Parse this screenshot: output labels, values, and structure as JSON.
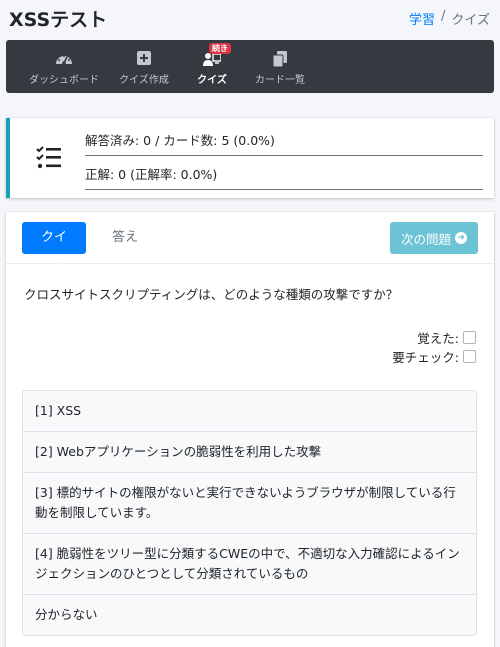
{
  "header": {
    "title": "XSSテスト",
    "breadcrumb": {
      "link": "学習",
      "separator": "/",
      "current": "クイズ"
    }
  },
  "nav": {
    "items": [
      {
        "label": "ダッシュボード",
        "icon": "gauge-icon"
      },
      {
        "label": "クイズ作成",
        "icon": "plus-square-icon"
      },
      {
        "label": "クイズ",
        "icon": "user-chalkboard-icon",
        "badge": "続き",
        "active": true
      },
      {
        "label": "カード一覧",
        "icon": "copy-icon"
      }
    ]
  },
  "stats": {
    "answered": "解答済み: 0 / カード数: 5 (0.0%)",
    "correct": "正解: 0 (正解率: 0.0%)",
    "icon": "tasks-list-icon"
  },
  "tabs": {
    "quiz": "クイズ",
    "answer": "答え"
  },
  "next_button": "次の問題",
  "question": "クロスサイトスクリプティングは、どのような種類の攻撃ですか？",
  "checks": {
    "remembered": "覚えた:",
    "needs_check": "要チェック:"
  },
  "choices": [
    "[1] XSS",
    "[2] Webアプリケーションの脆弱性を利用した攻撃",
    "[3] 標的サイトの権限がないと実行できないようブラウザが制限している行動を制限しています。",
    "[4] 脆弱性をツリー型に分類するCWEの中で、不適切な入力確認によるインジェクションのひとつとして分類されているもの",
    "分からない"
  ],
  "colors": {
    "accent": "#007bff",
    "info": "#17a2b8",
    "nav_bg": "#343a40",
    "badge": "#dc3545"
  }
}
